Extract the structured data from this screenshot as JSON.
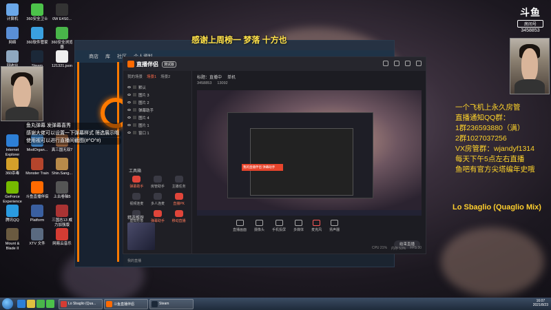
{
  "overlay": {
    "banner": "感谢上周榜一 梦落  十方也",
    "platform_logo_top": "斗鱼",
    "platform_logo_sub": "房间号",
    "room_number": "3458853",
    "info_lines": [
      "一个飞机上永久房管",
      "直播通知QQ群：",
      "1群236593880（满）",
      "2群1027037256",
      "VX房管群：wjandyf1314",
      "每天下午5点左右直播",
      "鱼吧有官方尖塔编年史哦"
    ],
    "now_playing": "Lo Sbaglio (Quaglio Mix)",
    "danmu": [
      "鱼丸弹幕 发弹幕喜秀",
      "感谢大佬可以设置一下弹幕样式 筛选展示哦",
      "使用视可以进行直播间截图(#^O^#)"
    ]
  },
  "desktop_icons": [
    {
      "label": "计算机",
      "color": "#6aa7e8"
    },
    {
      "label": "360安全卫士",
      "color": "#4cc24a"
    },
    {
      "label": "0W E4S0...",
      "color": "#333"
    },
    {
      "label": "网络",
      "color": "#5a8fd6"
    },
    {
      "label": "360软件管家",
      "color": "#3aa0e0"
    },
    {
      "label": "360安全浏览器",
      "color": "#49b64a"
    },
    {
      "label": "回收站",
      "color": "#8fa8c0"
    },
    {
      "label": "Steam",
      "color": "#1b2838"
    },
    {
      "label": "121321.json",
      "color": "#eee"
    },
    {
      "label": "Internet Explorer",
      "color": "#2d7fd6"
    },
    {
      "label": "ModOrgan...",
      "color": "#3a7ab8"
    },
    {
      "label": "真三国无双7",
      "color": "#8a5a3a"
    },
    {
      "label": "360杀毒",
      "color": "#d4a02a"
    },
    {
      "label": "Monster Train",
      "color": "#b5452c"
    },
    {
      "label": "Shin.Sang...",
      "color": "#b88a4a"
    },
    {
      "label": "GeForce Experience",
      "color": "#76b900"
    },
    {
      "label": "斗鱼直播伴侣",
      "color": "#ff6a00"
    },
    {
      "label": "上古卷轴5",
      "color": "#555"
    },
    {
      "label": "腾讯QQ",
      "color": "#2a9be0"
    },
    {
      "label": "Platform",
      "color": "#3a5fa0"
    },
    {
      "label": "三国志13 威力加强版",
      "color": "#a33"
    },
    {
      "label": "Mount & Blade II",
      "color": "#6a5a40"
    },
    {
      "label": "XTV 文件",
      "color": "#5a6a80"
    },
    {
      "label": "网易云音乐",
      "color": "#d43c33"
    }
  ],
  "store_window": {
    "nav": [
      "商店",
      "库",
      "社区",
      "个人资料"
    ]
  },
  "app": {
    "title": "直播伴侣",
    "beta_badge": "测试版",
    "side_tabs": [
      "我的场景",
      "场景1",
      "场景2"
    ],
    "scenes": [
      "默认",
      "图片 3",
      "图片 2",
      "弹幕助手",
      "图片 4",
      "图片 1",
      "窗口 1"
    ],
    "tools_title": "工具箱",
    "tools": [
      {
        "label": "弹幕助手",
        "hot": true
      },
      {
        "label": "房管助手",
        "hot": false
      },
      {
        "label": "主播任务",
        "hot": false
      },
      {
        "label": "视频连麦",
        "hot": false
      },
      {
        "label": "多人连麦",
        "hot": false
      },
      {
        "label": "直播PK",
        "hot": true
      },
      {
        "label": "虚拟形象",
        "hot": false
      },
      {
        "label": "弹幕助手",
        "hot": true
      },
      {
        "label": "移动直播",
        "hot": true
      }
    ],
    "promo_title": "精选推荐",
    "bottom_left": "我的直播",
    "room_title_label": "标题：",
    "room_title": "直播中",
    "room_category": "单机",
    "room_id": "3458853",
    "room_fans": "13092",
    "nested_bar_text": "我的直播伴侣  弹幕助手",
    "controls": [
      {
        "label": "直播画面",
        "name": "scene-control"
      },
      {
        "label": "摄像头",
        "name": "camera-control"
      },
      {
        "label": "手机投屏",
        "name": "phone-cast-control"
      },
      {
        "label": "多媒体",
        "name": "media-control"
      },
      {
        "label": "麦克风",
        "name": "mic-control"
      },
      {
        "label": "扬声器",
        "name": "speaker-control"
      }
    ],
    "start_button": "结束直播",
    "status": [
      "CPU 21%",
      "内存 53%",
      "FPS 30"
    ]
  },
  "taskbar": {
    "buttons": [
      {
        "label": "Lo Sbaglio (Qua...",
        "color": "#d43c33"
      },
      {
        "label": "斗鱼直播伴侣",
        "color": "#ff6a00"
      },
      {
        "label": "Steam",
        "color": "#1b2838"
      }
    ],
    "time": "16:07",
    "date": "2021/8/23"
  }
}
